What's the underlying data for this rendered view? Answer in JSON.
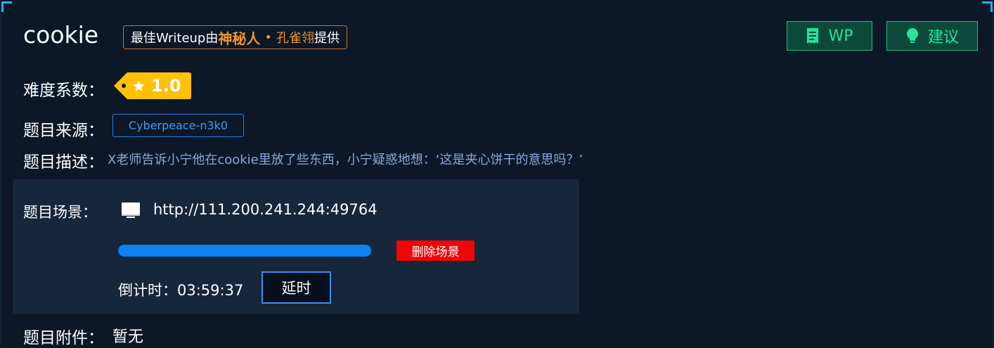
{
  "challenge": {
    "title": "cookie",
    "writeup_badge": {
      "prefix": "最佳Writeup由",
      "author": "神秘人",
      "separator": "•",
      "author2": "孔雀翎",
      "suffix": "提供"
    }
  },
  "actions": {
    "wp_label": "WP",
    "suggest_label": "建议"
  },
  "info": {
    "difficulty_label": "难度系数：",
    "difficulty_value": "1.0",
    "source_label": "题目来源：",
    "source_value": "Cyberpeace-n3k0",
    "desc_label": "题目描述：",
    "desc_value": "X老师告诉小宁他在cookie里放了些东西，小宁疑惑地想：‘这是夹心饼干的意思吗？’"
  },
  "scene": {
    "label": "题目场景：",
    "url": "http://111.200.241.244:49764",
    "progress_percent": 99,
    "delete_label": "删除场景",
    "countdown_label": "倒计时：",
    "countdown_value": "03:59:37",
    "extend_label": "延时"
  },
  "attachment": {
    "label": "题目附件：",
    "value": "暂无"
  },
  "colors": {
    "accent_green": "#27e49a",
    "badge_orange": "#f0942c",
    "progress_blue": "#1180f2",
    "delete_red": "#ee0707",
    "difficulty_yellow": "#ffc107"
  },
  "icons": {
    "wp": "receipt-icon",
    "suggest": "lightbulb-icon",
    "difficulty": "star-icon",
    "scene": "monitor-icon"
  }
}
